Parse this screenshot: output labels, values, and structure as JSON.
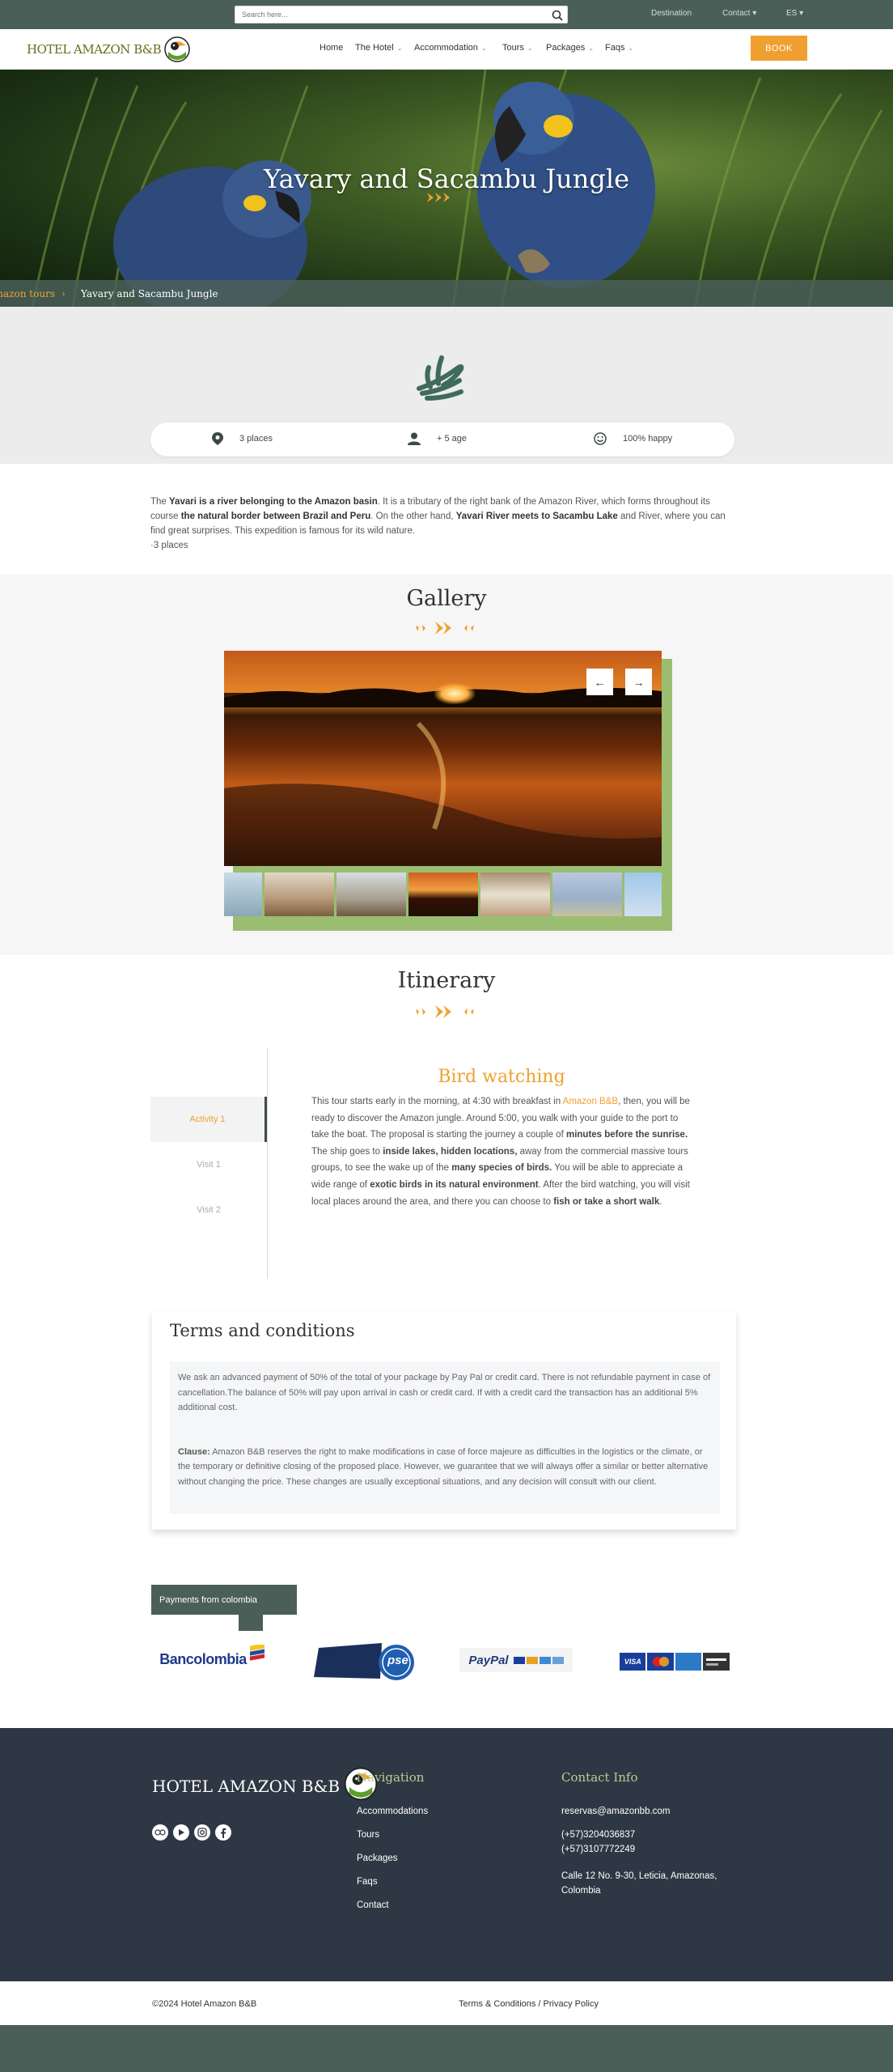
{
  "topbar": {
    "search_placeholder": "Search here...",
    "links": [
      "Destination",
      "Contact",
      "ES"
    ]
  },
  "nav": {
    "logo_text": "HOTEL AMAZON B&B",
    "items": [
      {
        "label": "Home",
        "dropdown": false
      },
      {
        "label": "The Hotel",
        "dropdown": true
      },
      {
        "label": "Accommodation",
        "dropdown": true
      },
      {
        "label": "Tours",
        "dropdown": true
      },
      {
        "label": "Packages",
        "dropdown": true
      },
      {
        "label": "Faqs",
        "dropdown": true
      }
    ],
    "book_label": "BOOK",
    "book_color": "#f0a030"
  },
  "hero": {
    "title": "Yavary and Sacambu Jungle",
    "breadcrumb": [
      "Amazon tours",
      "Yavary and Sacambu Jungle"
    ]
  },
  "stats": [
    {
      "icon": "map-pin-icon",
      "text": "3 places"
    },
    {
      "icon": "user-icon",
      "text": "+ 5 age"
    },
    {
      "icon": "smiley-icon",
      "text": "100% happy"
    }
  ],
  "intro": {
    "p1_a": "The ",
    "p1_b": "Yavari is a river belonging to the Amazon basin",
    "p1_c": ". It is a tributary of the right bank of the Amazon River, which forms throughout its course ",
    "p1_d": "the natural border between Brazil and Peru",
    "p1_e": ". On the other hand, ",
    "p1_f": "Yavari River meets to Sacambu Lake",
    "p1_g": " and River, where you can find great surprises. This expedition is famous for its wild nature.",
    "p2": "3 places"
  },
  "gallery": {
    "title": "Gallery",
    "prev": "←",
    "next": "→"
  },
  "itinerary": {
    "title": "Itinerary",
    "tabs": [
      "Activity 1",
      "Visit 1",
      "Visit 2"
    ],
    "active_heading": "Bird watching",
    "body": [
      {
        "t": "This tour starts early in the morning, at 4:30 with breakfast in ",
        "s": "n"
      },
      {
        "t": "Amazon B&B",
        "s": "o"
      },
      {
        "t": ", then, you will be ready to discover the Amazon jungle. Around 5:00, you walk with your guide to the port to take the boat. The proposal is starting the journey a couple of ",
        "s": "n"
      },
      {
        "t": "minutes before the sunrise.",
        "s": "b"
      },
      {
        "t": " The ship goes to ",
        "s": "n"
      },
      {
        "t": "inside lakes, hidden locations,",
        "s": "b"
      },
      {
        "t": "  away from the commercial massive tours groups, to see the wake up of the ",
        "s": "n"
      },
      {
        "t": "many species of birds.",
        "s": "b"
      },
      {
        "t": " You will be able to appreciate a wide range of ",
        "s": "n"
      },
      {
        "t": "exotic birds in its natural environment",
        "s": "b"
      },
      {
        "t": ". After the bird watching, you will visit local places around the area, and there you can choose to ",
        "s": "n"
      },
      {
        "t": "fish or take a short walk",
        "s": "b"
      },
      {
        "t": ".",
        "s": "n"
      }
    ]
  },
  "terms": {
    "title": "Terms and conditions",
    "p1": "We ask an advanced payment of 50% of the total of your package by Pay Pal or credit card. There is not refundable payment in case of cancellation.The balance of 50% will pay upon arrival in cash or credit card. If with a credit card the transaction has an additional 5% additional cost.",
    "clause_label": "Clause:",
    "clause_text": " Amazon B&B reserves the right to make modifications in case of force majeure as difficulties in the logistics or the climate, or the temporary or definitive closing of the proposed place. However, we guarantee that we will always offer a similar or better alternative without changing the price. These changes are usually exceptional situations, and any decision will consult with our client."
  },
  "payments": {
    "tab_label": "Payments from colombia",
    "bancolombia": "Bancolombia",
    "pse": "pse",
    "paypal": "PayPal",
    "cards": [
      "VISA",
      "MasterCard",
      "AMEX"
    ]
  },
  "footer": {
    "logo_text": "HOTEL AMAZON B&B",
    "nav_heading": "Navigation",
    "nav_links": [
      "Accommodations",
      "Tours",
      "Packages",
      "Faqs",
      "Contact"
    ],
    "contact_heading": "Contact Info",
    "email": "reservas@amazonbb.com",
    "phone1": "(+57)3204036837",
    "phone2": "(+57)3107772249",
    "address": "Calle 12 No. 9-30, Leticia, Amazonas, Colombia",
    "socials": [
      "tripadvisor-icon",
      "youtube-icon",
      "instagram-icon",
      "facebook-icon"
    ]
  },
  "bottom": {
    "copyright": "©2024 Hotel Amazon B&B",
    "legal": "Terms & Conditions / Privacy Policy"
  },
  "colors": {
    "dark_green": "#4a5f58",
    "accent_orange": "#f0a030",
    "footer_bg": "#2e3844",
    "footer_heading": "#b9cf92",
    "gallery_frame": "#9bbd72"
  }
}
